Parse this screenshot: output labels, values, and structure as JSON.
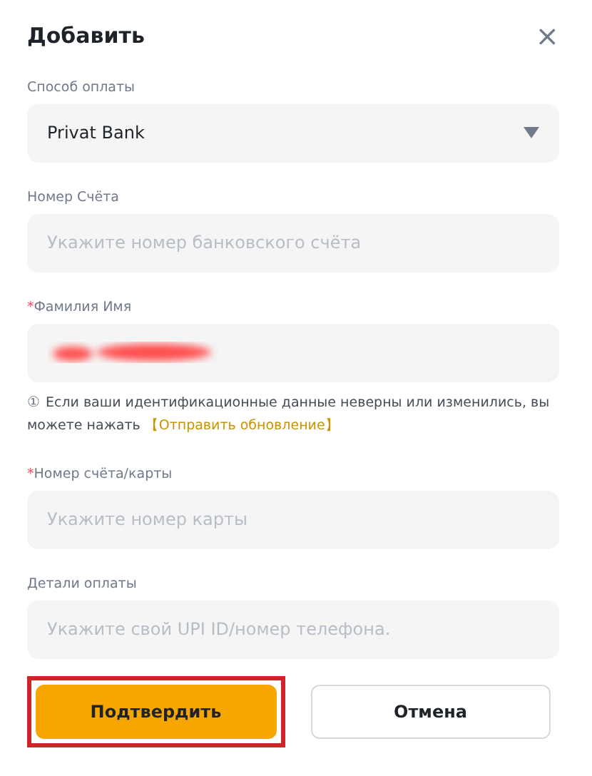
{
  "dialog": {
    "title": "Добавить",
    "close": "×"
  },
  "fields": [
    {
      "kind": "select",
      "label": "Способ оплаты",
      "value": "Privat Bank"
    },
    {
      "kind": "input",
      "label": "Номер Счёта",
      "placeholder": "Укажите номер банковского счёта"
    },
    {
      "kind": "redacted",
      "required_mark": "*",
      "label": "Фамилия Имя",
      "note": {
        "icon": "①",
        "text": "Если ваши идентификационные данные неверны или изменились, вы можете нажать",
        "link": "【Отправить обновление】"
      }
    },
    {
      "kind": "input",
      "required_mark": "*",
      "label": "Номер счёта/карты",
      "placeholder": "Укажите номер карты"
    },
    {
      "kind": "input",
      "label": "Детали оплаты",
      "placeholder": "Укажите свой UPI ID/номер телефона."
    }
  ],
  "buttons": [
    {
      "kind": "primary",
      "label": "Подтвердить",
      "highlighted": true
    },
    {
      "kind": "secondary",
      "label": "Отмена",
      "highlighted": false
    }
  ]
}
